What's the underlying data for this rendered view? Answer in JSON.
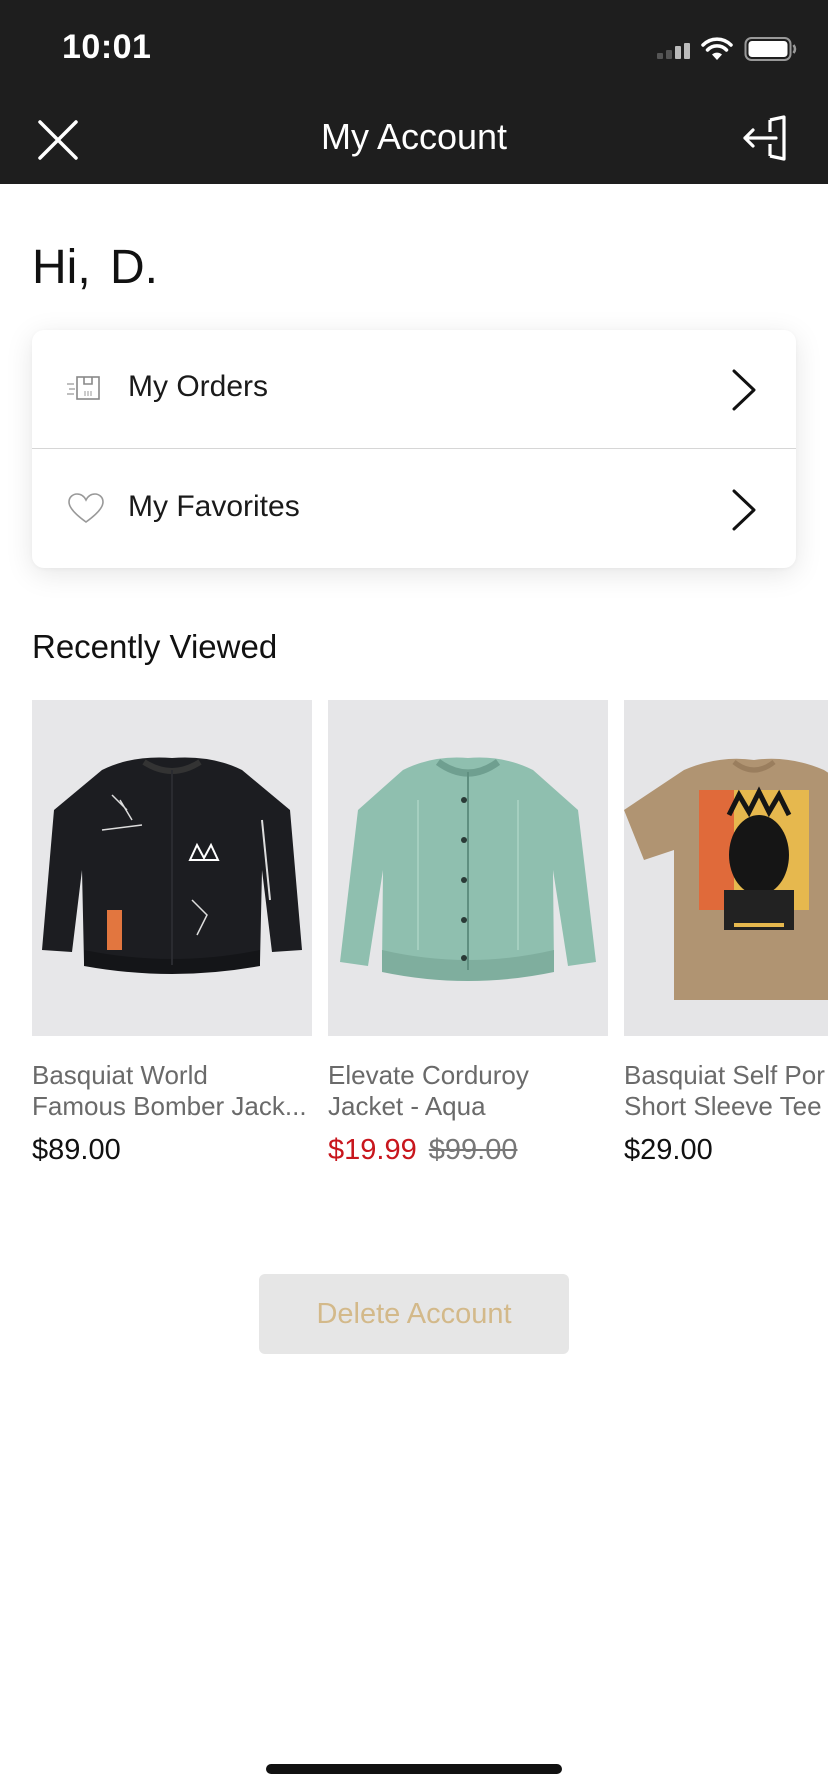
{
  "status_bar": {
    "time": "10:01"
  },
  "nav": {
    "title": "My Account"
  },
  "greeting": {
    "hi": "Hi,",
    "name": "D."
  },
  "menu": [
    {
      "label": "My Orders",
      "icon": "orders-box-icon"
    },
    {
      "label": "My Favorites",
      "icon": "heart-icon"
    }
  ],
  "recently_viewed": {
    "title": "Recently Viewed",
    "products": [
      {
        "name_line1": "Basquiat World",
        "name_line2": "Famous Bomber Jack...",
        "price": "$89.00"
      },
      {
        "name_line1": "Elevate Corduroy",
        "name_line2": "Jacket - Aqua",
        "sale_price": "$19.99",
        "original_price": "$99.00"
      },
      {
        "name_line1": "Basquiat Self Por",
        "name_line2": "Short Sleeve Tee",
        "price": "$29.00"
      }
    ]
  },
  "delete_account": {
    "label": "Delete Account"
  },
  "colors": {
    "topbar": "#1e1e1e",
    "sale_red": "#c8161d",
    "delete_text": "#d3b98a",
    "delete_bg": "#e6e6e6"
  }
}
